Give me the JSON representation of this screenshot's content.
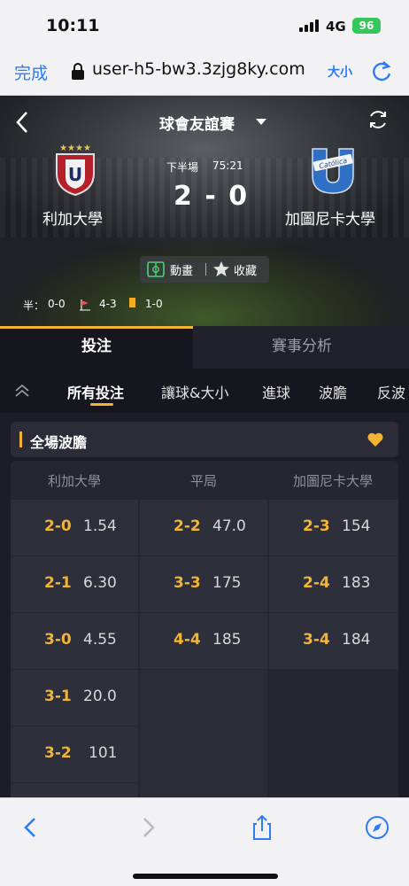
{
  "status_bar": {
    "time": "10:11",
    "network": "4G",
    "battery": "96"
  },
  "browser": {
    "done_label": "完成",
    "url": "user-h5-bw3.3zjg8ky.com",
    "text_size_label": "大小"
  },
  "match": {
    "tournament": "球會友誼賽",
    "period": "下半場",
    "clock": "75:21",
    "score": "2 - 0",
    "home_team": "利加大學",
    "away_team": "加圖尼卡大學",
    "animation_label": "動畫",
    "favorite_label": "收藏",
    "stats": {
      "half_label": "半：",
      "half_score": "0-0",
      "corners": "4-3",
      "cards": "1-0"
    }
  },
  "main_tabs": {
    "bet": "投注",
    "analysis": "賽事分析"
  },
  "sub_tabs": [
    "所有投注",
    "讓球&大小",
    "進球",
    "波膽",
    "反波"
  ],
  "market": {
    "title": "全場波膽",
    "columns": [
      "利加大學",
      "平局",
      "加圖尼卡大學"
    ],
    "home": [
      {
        "score": "2-0",
        "odds": "1.54"
      },
      {
        "score": "2-1",
        "odds": "6.30"
      },
      {
        "score": "3-0",
        "odds": "4.55"
      },
      {
        "score": "3-1",
        "odds": "20.0"
      },
      {
        "score": "3-2",
        "odds": "101"
      }
    ],
    "draw": [
      {
        "score": "2-2",
        "odds": "47.0"
      },
      {
        "score": "3-3",
        "odds": "175"
      },
      {
        "score": "4-4",
        "odds": "185"
      }
    ],
    "away": [
      {
        "score": "2-3",
        "odds": "154"
      },
      {
        "score": "2-4",
        "odds": "183"
      },
      {
        "score": "3-4",
        "odds": "184"
      }
    ]
  },
  "colors": {
    "accent": "#f3b434",
    "ios_blue": "#2d7cf6",
    "battery_green": "#35c759"
  },
  "icons": [
    "lock-icon",
    "reload-icon",
    "back-icon",
    "caret-down-icon",
    "refresh-icon",
    "animation-icon",
    "star-icon",
    "corner-flag-icon",
    "yellow-card-icon",
    "collapse-icon",
    "heart-icon",
    "share-icon",
    "compass-icon"
  ]
}
